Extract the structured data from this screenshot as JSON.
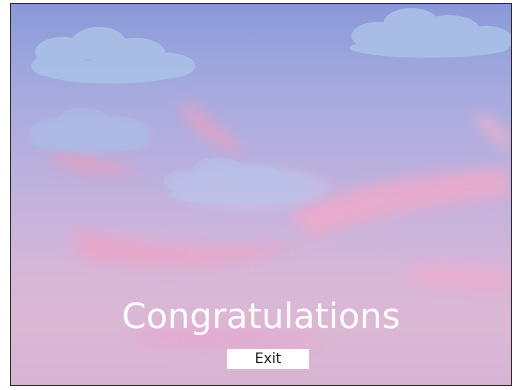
{
  "screen": {
    "title": "Congratulations",
    "exit_label": "Exit"
  },
  "colors": {
    "sky_top": "#8a98d8",
    "sky_bottom": "#d8b4d3",
    "cloud_blue": "#a9c0e6",
    "streak_pink": "#f0a6c6",
    "text": "#ffffff",
    "button_bg": "#ffffff"
  }
}
